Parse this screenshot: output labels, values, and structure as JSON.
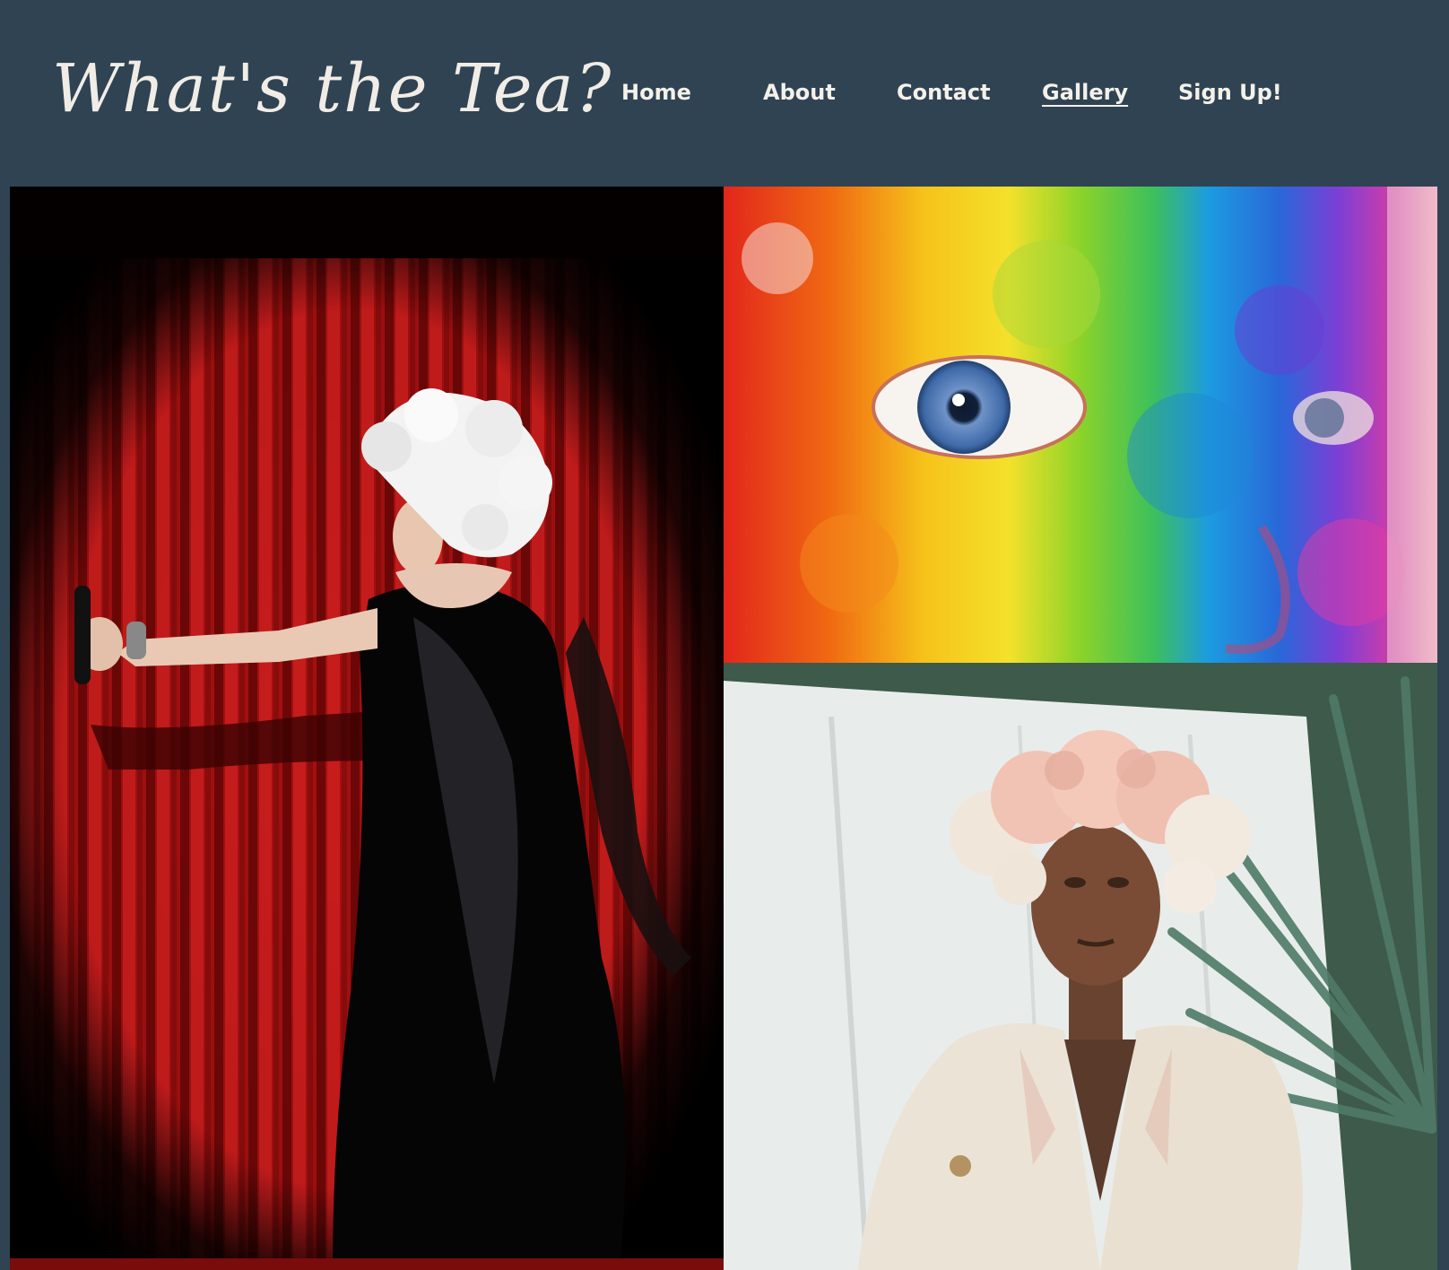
{
  "site": {
    "logo_text": "What's the Tea?"
  },
  "nav": {
    "items": [
      {
        "label": "Home",
        "active": false
      },
      {
        "label": "About",
        "active": false
      },
      {
        "label": "Contact",
        "active": false
      },
      {
        "label": "Gallery",
        "active": true
      },
      {
        "label": "Sign Up!",
        "active": false
      }
    ]
  },
  "gallery": {
    "images": [
      {
        "name": "drag-performer-stage-photo"
      },
      {
        "name": "rainbow-face-paint-photo"
      },
      {
        "name": "flower-crown-portrait-photo"
      }
    ]
  },
  "colors": {
    "header_bg": "#2f4353",
    "text": "#f4f1ea",
    "curtain_red": "#b01414"
  }
}
